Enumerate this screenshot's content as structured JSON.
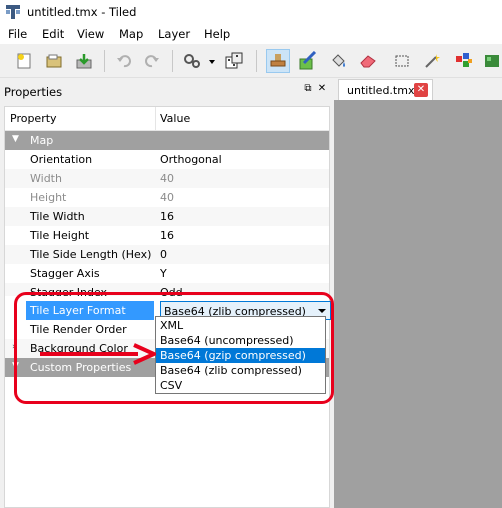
{
  "window": {
    "title": "untitled.tmx - Tiled"
  },
  "menu": [
    "File",
    "Edit",
    "View",
    "Map",
    "Layer",
    "Help"
  ],
  "toolbar": {
    "icons": [
      "new-icon",
      "open-icon",
      "save-icon",
      "undo-icon",
      "redo-icon",
      "commands-icon",
      "random-mode-icon",
      "stamp-brush-icon",
      "terrain-brush-icon",
      "bucket-fill-icon",
      "eraser-icon",
      "rectangle-select-icon",
      "magic-wand-icon",
      "select-same-tile-icon"
    ]
  },
  "properties_panel": {
    "title": "Properties",
    "col_property": "Property",
    "col_value": "Value",
    "group_map": "Map",
    "group_custom": "Custom Properties",
    "rows": [
      {
        "name": "Orientation",
        "value": "Orthogonal",
        "disabled": false
      },
      {
        "name": "Width",
        "value": "40",
        "disabled": true
      },
      {
        "name": "Height",
        "value": "40",
        "disabled": true
      },
      {
        "name": "Tile Width",
        "value": "16",
        "disabled": false
      },
      {
        "name": "Tile Height",
        "value": "16",
        "disabled": false
      },
      {
        "name": "Tile Side Length (Hex)",
        "value": "0",
        "disabled": false
      },
      {
        "name": "Stagger Axis",
        "value": "Y",
        "disabled": false
      },
      {
        "name": "Stagger Index",
        "value": "Odd",
        "disabled": false
      },
      {
        "name": "Tile Layer Format",
        "value": "Base64 (zlib compressed)",
        "disabled": false
      },
      {
        "name": "Tile Render Order",
        "value": "",
        "disabled": false
      },
      {
        "name": "Background Color",
        "value": "",
        "disabled": false
      }
    ],
    "dropdown_options": [
      "XML",
      "Base64 (uncompressed)",
      "Base64 (gzip compressed)",
      "Base64 (zlib compressed)",
      "CSV"
    ],
    "highlighted_option": "Base64 (gzip compressed)"
  },
  "editor": {
    "tab_label": "untitled.tmx",
    "tab_close": "✕"
  },
  "colors": {
    "accent": "#0078d7",
    "annotation": "#e8001c",
    "group_header": "#a0a0a0"
  }
}
